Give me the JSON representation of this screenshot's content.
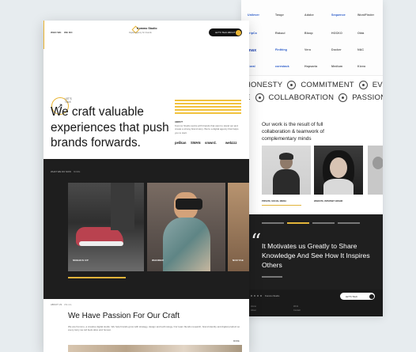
{
  "back": {
    "logos": [
      {
        "text": "Unilever",
        "cls": "blue"
      },
      {
        "text": "Twopr",
        "cls": ""
      },
      {
        "text": "Adobe",
        "cls": ""
      },
      {
        "text": "Sequence",
        "cls": "blue"
      },
      {
        "text": "WordFinder",
        "cls": ""
      },
      {
        "text": "TripCo",
        "cls": "blue"
      },
      {
        "text": "Rakuul",
        "cls": ""
      },
      {
        "text": "Bloop",
        "cls": ""
      },
      {
        "text": "HOCKO",
        "cls": ""
      },
      {
        "text": "Okta",
        "cls": ""
      },
      {
        "text": "max",
        "cls": "big"
      },
      {
        "text": "Finthing",
        "cls": "blue"
      },
      {
        "text": "Vero",
        "cls": ""
      },
      {
        "text": "Docker",
        "cls": ""
      },
      {
        "text": "N&C",
        "cls": ""
      },
      {
        "text": "Coral",
        "cls": "blue"
      },
      {
        "text": "corestack",
        "cls": "blue"
      },
      {
        "text": "Hopsaria",
        "cls": ""
      },
      {
        "text": "Medium",
        "cls": ""
      },
      {
        "text": "Kivvo",
        "cls": ""
      }
    ],
    "values_row1": [
      "HONESTY",
      "COMMITMENT",
      "EVOLUTION"
    ],
    "values_row2": [
      "E",
      "COLLABORATION",
      "PASSION"
    ],
    "team_heading": "Our work is the result of full collaboration & teamwork of complementary minds",
    "team": [
      {
        "name": "PRIVATE, SOCIAL MEDIA"
      },
      {
        "name": "WEBSITE, INTERNET BRAND"
      }
    ],
    "quote": "It Motivates us Greatly to Share Knowledge And See How It Inspires Others",
    "footer_brand": "Kommo Studio",
    "footer_btn": "LET'S TALK",
    "footer_cols": [
      "Home",
      "About",
      "Work",
      "Contact"
    ]
  },
  "front": {
    "nav_left": [
      "WHO WE",
      "WE DO"
    ],
    "brand_name": "Kommo Studio",
    "brand_tag": "Digital agency for brands",
    "contact_label": "LET'S TALK ABOUT IT",
    "badge_text": "LET'S TALK",
    "hero_title": "We craft valuable experiences that push brands forwards.",
    "about_label": "ABOUT",
    "about_text": "Kommo Studio works with brands that want to stand out and create a strong brand story. We're a digital agency that helps you to start.",
    "clients": [
      "pelikan",
      "SWAN",
      "smwrd.",
      "webzzz"
    ],
    "work_label": "WHAT WE DO NOW",
    "work_label2": "MORE",
    "tiles": [
      {
        "label": "SNEAKS UP",
        "sub": "Footwear campaign"
      },
      {
        "label": "WANDER",
        "sub": "VR experience"
      },
      {
        "label": "NOCTAE",
        "sub": "Lifestyle"
      }
    ],
    "passion_label": "ABOUT US",
    "passion_label2": "WE ALL",
    "passion_title": "We Have Passion For Our Craft",
    "passion_text": "We are Kommo, a creative digital studio. We help brands grow with strategy, design and technology. Our team blends research, brand identity and digital product so every story we tell feels alive and honest.",
    "passion_link": "MORE"
  },
  "colors": {
    "accent": "#e9b431",
    "dark": "#1e1e1e"
  }
}
